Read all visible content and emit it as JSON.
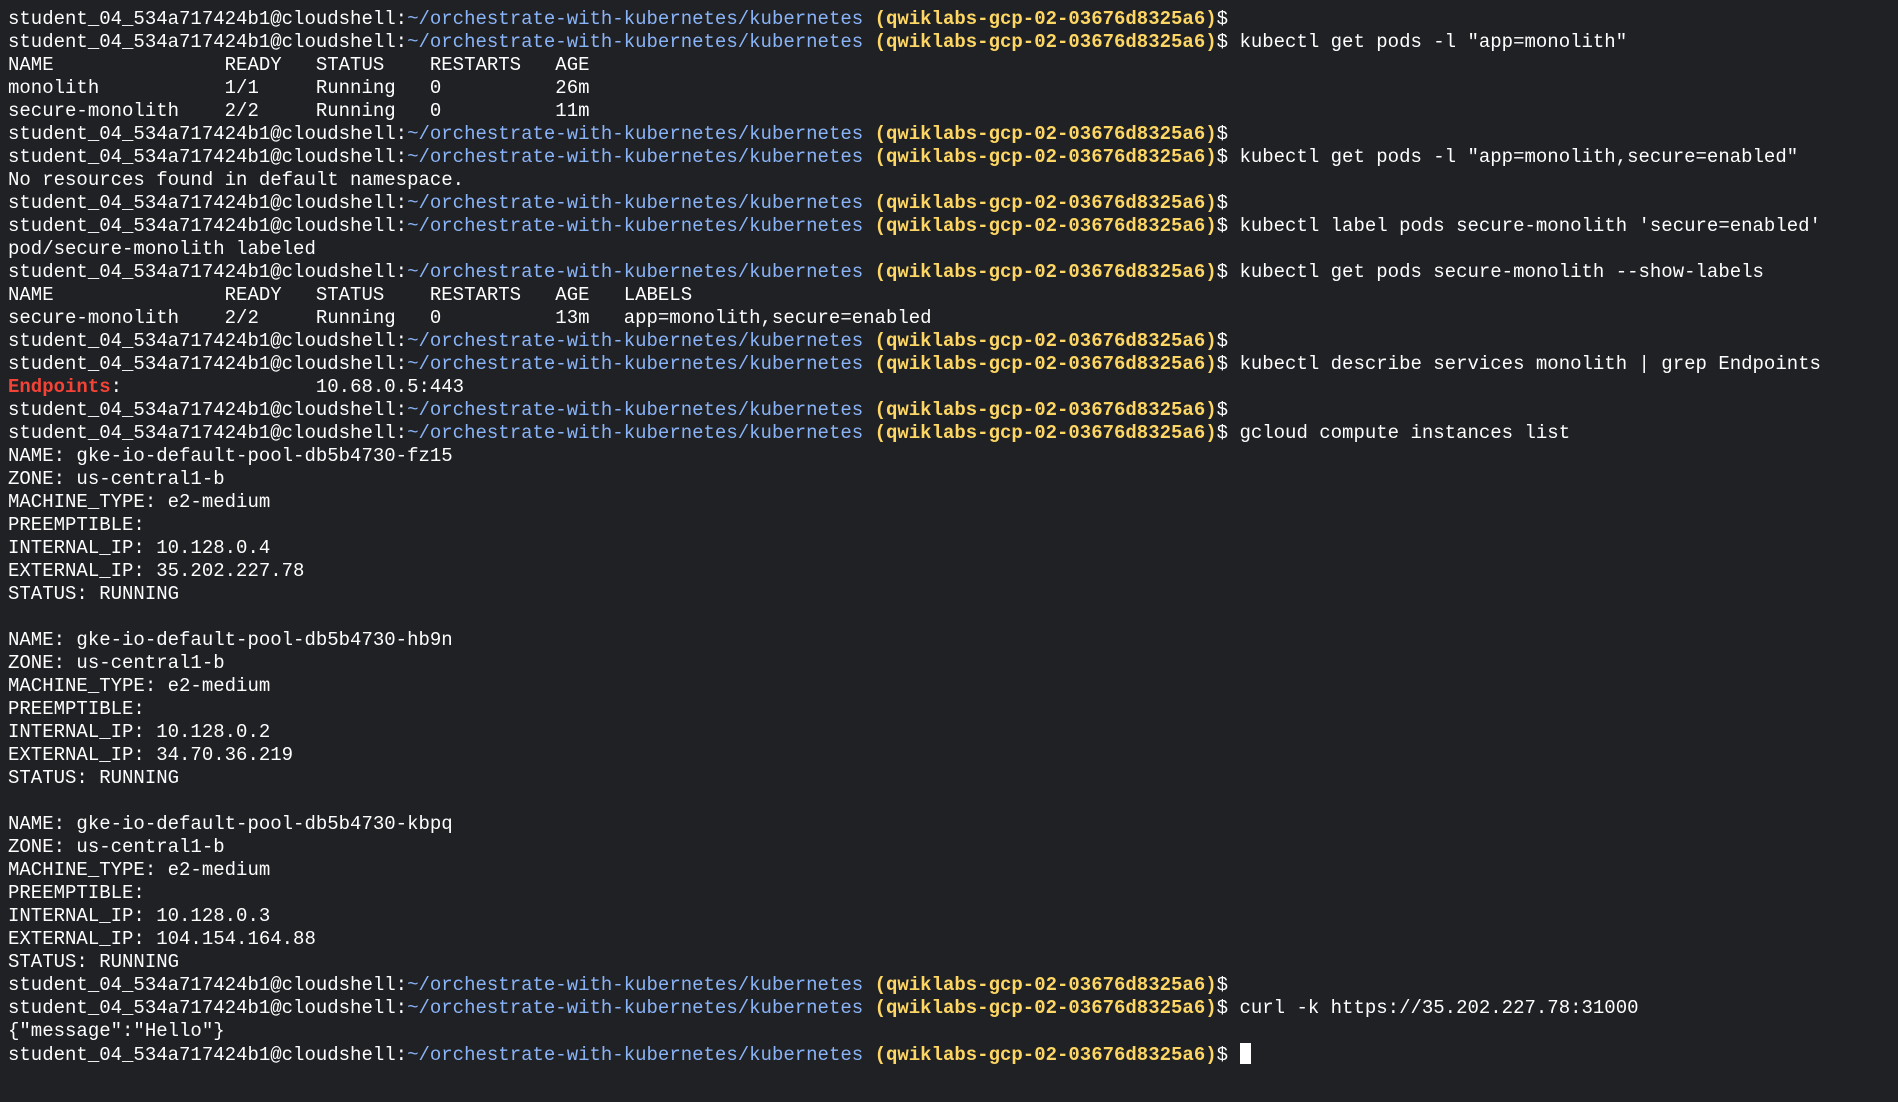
{
  "terminal": {
    "lines": [
      {
        "type": "prompt",
        "cmd": ""
      },
      {
        "type": "prompt",
        "cmd": "kubectl get pods -l \"app=monolith\""
      },
      {
        "type": "out",
        "text": "NAME               READY   STATUS    RESTARTS   AGE"
      },
      {
        "type": "out",
        "text": "monolith           1/1     Running   0          26m"
      },
      {
        "type": "out",
        "text": "secure-monolith    2/2     Running   0          11m"
      },
      {
        "type": "prompt",
        "cmd": ""
      },
      {
        "type": "prompt",
        "cmd": "kubectl get pods -l \"app=monolith,secure=enabled\""
      },
      {
        "type": "out",
        "text": "No resources found in default namespace."
      },
      {
        "type": "prompt",
        "cmd": ""
      },
      {
        "type": "prompt",
        "cmd": "kubectl label pods secure-monolith 'secure=enabled'"
      },
      {
        "type": "out",
        "text": "pod/secure-monolith labeled"
      },
      {
        "type": "prompt",
        "cmd": "kubectl get pods secure-monolith --show-labels"
      },
      {
        "type": "out",
        "text": "NAME               READY   STATUS    RESTARTS   AGE   LABELS"
      },
      {
        "type": "out",
        "text": "secure-monolith    2/2     Running   0          13m   app=monolith,secure=enabled"
      },
      {
        "type": "prompt",
        "cmd": ""
      },
      {
        "type": "prompt",
        "cmd": "kubectl describe services monolith | grep Endpoints"
      },
      {
        "type": "kv",
        "key": "Endpoints",
        "rest": ":                 10.68.0.5:443"
      },
      {
        "type": "prompt",
        "cmd": ""
      },
      {
        "type": "prompt",
        "cmd": "gcloud compute instances list"
      },
      {
        "type": "out",
        "text": "NAME: gke-io-default-pool-db5b4730-fz15"
      },
      {
        "type": "out",
        "text": "ZONE: us-central1-b"
      },
      {
        "type": "out",
        "text": "MACHINE_TYPE: e2-medium"
      },
      {
        "type": "out",
        "text": "PREEMPTIBLE:"
      },
      {
        "type": "out",
        "text": "INTERNAL_IP: 10.128.0.4"
      },
      {
        "type": "out",
        "text": "EXTERNAL_IP: 35.202.227.78"
      },
      {
        "type": "out",
        "text": "STATUS: RUNNING"
      },
      {
        "type": "out",
        "text": ""
      },
      {
        "type": "out",
        "text": "NAME: gke-io-default-pool-db5b4730-hb9n"
      },
      {
        "type": "out",
        "text": "ZONE: us-central1-b"
      },
      {
        "type": "out",
        "text": "MACHINE_TYPE: e2-medium"
      },
      {
        "type": "out",
        "text": "PREEMPTIBLE:"
      },
      {
        "type": "out",
        "text": "INTERNAL_IP: 10.128.0.2"
      },
      {
        "type": "out",
        "text": "EXTERNAL_IP: 34.70.36.219"
      },
      {
        "type": "out",
        "text": "STATUS: RUNNING"
      },
      {
        "type": "out",
        "text": ""
      },
      {
        "type": "out",
        "text": "NAME: gke-io-default-pool-db5b4730-kbpq"
      },
      {
        "type": "out",
        "text": "ZONE: us-central1-b"
      },
      {
        "type": "out",
        "text": "MACHINE_TYPE: e2-medium"
      },
      {
        "type": "out",
        "text": "PREEMPTIBLE:"
      },
      {
        "type": "out",
        "text": "INTERNAL_IP: 10.128.0.3"
      },
      {
        "type": "out",
        "text": "EXTERNAL_IP: 104.154.164.88"
      },
      {
        "type": "out",
        "text": "STATUS: RUNNING"
      },
      {
        "type": "prompt",
        "cmd": ""
      },
      {
        "type": "prompt",
        "cmd": "curl -k https://35.202.227.78:31000"
      },
      {
        "type": "out",
        "text": "{\"message\":\"Hello\"}"
      },
      {
        "type": "prompt",
        "cmd": "",
        "cursor": true
      }
    ],
    "prompt": {
      "user": "student_04_534a717424b1@cloudshell:",
      "path": "~/orchestrate-with-kubernetes/kubernetes",
      "project": "(qwiklabs-gcp-02-03676d8325a6)",
      "symbol": "$"
    },
    "colors": {
      "background": "#202124",
      "text": "#ffffff",
      "path": "#8ab4f8",
      "project": "#fdd663",
      "highlight": "#f44336"
    }
  }
}
